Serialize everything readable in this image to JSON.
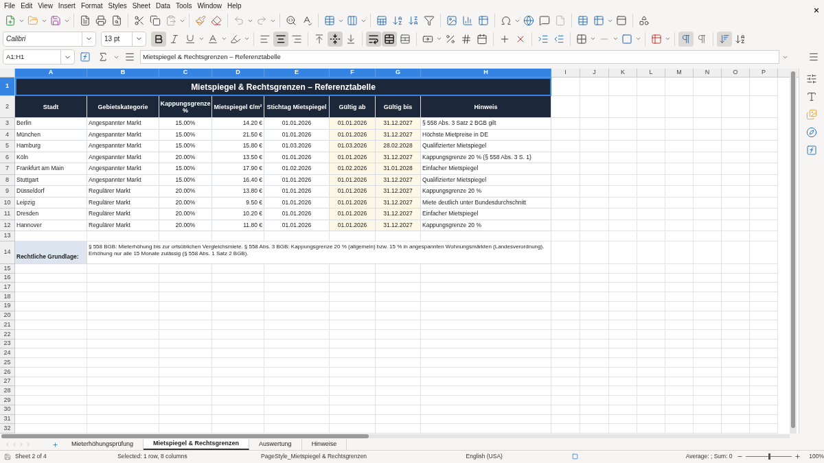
{
  "menu": [
    "File",
    "Edit",
    "View",
    "Insert",
    "Format",
    "Styles",
    "Sheet",
    "Data",
    "Tools",
    "Window",
    "Help"
  ],
  "format_toolbar": {
    "font_name": "Calibri",
    "font_size": "13 pt",
    "buttons": [
      {
        "active": true
      },
      {
        "active": false
      },
      {
        "active": false
      },
      {
        "active": false
      },
      {
        "active": false
      },
      {
        "active": false
      },
      {
        "active": true
      },
      {
        "active": false
      },
      {
        "active": false
      },
      {
        "active": true
      },
      {
        "active": false
      },
      {
        "active": true
      },
      {
        "active": true
      },
      {
        "active": false
      }
    ]
  },
  "formula_bar": {
    "cell_ref": "A1:H1",
    "content": "Mietspiegel & Rechtsgrenzen – Referenztabelle"
  },
  "columns": [
    {
      "label": "A",
      "selected": true
    },
    {
      "label": "B",
      "selected": true
    },
    {
      "label": "C",
      "selected": true
    },
    {
      "label": "D",
      "selected": true
    },
    {
      "label": "E",
      "selected": true
    },
    {
      "label": "F",
      "selected": true
    },
    {
      "label": "G",
      "selected": true
    },
    {
      "label": "H",
      "selected": true
    },
    {
      "label": "I",
      "selected": false
    },
    {
      "label": "J",
      "selected": false
    },
    {
      "label": "K",
      "selected": false
    },
    {
      "label": "L",
      "selected": false
    },
    {
      "label": "M",
      "selected": false
    },
    {
      "label": "N",
      "selected": false
    },
    {
      "label": "O",
      "selected": false
    },
    {
      "label": "P",
      "selected": false
    }
  ],
  "rows": [
    {
      "kind": "title",
      "number": "1",
      "selected": true,
      "text": "Mietspiegel & Rechtsgrenzen – Referenztabelle"
    },
    {
      "kind": "header",
      "number": "2",
      "selected": false,
      "cells": [
        "Stadt",
        "Gebietskategorie",
        "Kappungsgrenze %",
        "Mietspiegel €/m²",
        "Stichtag Mietspiegel",
        "Gültig ab",
        "Gültig bis",
        "Hinweis"
      ]
    },
    {
      "kind": "data",
      "number": "3",
      "selected": false,
      "cells": [
        "Berlin",
        "Angespannter Markt",
        "15.00%",
        "14.20 €",
        "01.01.2026",
        "01.01.2026",
        "31.12.2027",
        "§ 558 Abs. 3 Satz 2 BGB gilt"
      ]
    },
    {
      "kind": "data",
      "number": "4",
      "selected": false,
      "cells": [
        "München",
        "Angespannter Markt",
        "15.00%",
        "21.50 €",
        "01.01.2026",
        "01.01.2026",
        "31.12.2027",
        "Höchste Mietpreise in DE"
      ]
    },
    {
      "kind": "data",
      "number": "5",
      "selected": false,
      "cells": [
        "Hamburg",
        "Angespannter Markt",
        "15.00%",
        "15.80 €",
        "01.03.2026",
        "01.03.2026",
        "28.02.2028",
        "Qualifizierter Mietspiegel"
      ]
    },
    {
      "kind": "data",
      "number": "6",
      "selected": false,
      "cells": [
        "Köln",
        "Angespannter Markt",
        "20.00%",
        "13.50 €",
        "01.01.2026",
        "01.01.2026",
        "31.12.2027",
        "Kappungsgrenze 20 % (§ 558 Abs. 3 S. 1)"
      ]
    },
    {
      "kind": "data",
      "number": "7",
      "selected": false,
      "cells": [
        "Frankfurt am Main",
        "Angespannter Markt",
        "15.00%",
        "17.90 €",
        "01.02.2026",
        "01.02.2026",
        "31.01.2028",
        "Einfacher Mietspiegel"
      ]
    },
    {
      "kind": "data",
      "number": "8",
      "selected": false,
      "cells": [
        "Stuttgart",
        "Angespannter Markt",
        "15.00%",
        "16.40 €",
        "01.01.2026",
        "01.01.2026",
        "31.12.2027",
        "Qualifizierter Mietspiegel"
      ]
    },
    {
      "kind": "data",
      "number": "9",
      "selected": false,
      "cells": [
        "Düsseldorf",
        "Regulärer Markt",
        "20.00%",
        "13.80 €",
        "01.01.2026",
        "01.01.2026",
        "31.12.2027",
        "Kappungsgrenze 20 %"
      ]
    },
    {
      "kind": "data",
      "number": "10",
      "selected": false,
      "cells": [
        "Leipzig",
        "Regulärer Markt",
        "20.00%",
        "9.50 €",
        "01.01.2026",
        "01.01.2026",
        "31.12.2027",
        "Miete deutlich unter Bundesdurchschnitt"
      ]
    },
    {
      "kind": "data",
      "number": "11",
      "selected": false,
      "cells": [
        "Dresden",
        "Regulärer Markt",
        "20.00%",
        "10.20 €",
        "01.01.2026",
        "01.01.2026",
        "31.12.2027",
        "Einfacher Mietspiegel"
      ]
    },
    {
      "kind": "data",
      "number": "12",
      "selected": false,
      "cells": [
        "Hannover",
        "Regulärer Markt",
        "20.00%",
        "11.80 €",
        "01.01.2026",
        "01.01.2026",
        "31.12.2027",
        "Kappungsgrenze 20 %"
      ]
    },
    {
      "kind": "spacer",
      "number": "13",
      "selected": false
    },
    {
      "kind": "note",
      "number": "14",
      "selected": false,
      "label": "Rechtliche Grundlage:",
      "text": "§ 558 BGB: Mieterhöhung bis zur ortsüblichen Vergleichsmiete. § 558 Abs. 3 BGB: Kappungsgrenze 20 % (allgemein) bzw. 15 % in angespannten Wohnungsmärkten (Landesverordnung). Erhöhung nur alle 15 Monate zulässig (§ 558 Abs. 1 Satz 2 BGB)."
    },
    {
      "kind": "empty",
      "number": "15",
      "selected": false
    },
    {
      "kind": "empty",
      "number": "16",
      "selected": false
    },
    {
      "kind": "empty",
      "number": "17",
      "selected": false
    },
    {
      "kind": "empty",
      "number": "18",
      "selected": false
    },
    {
      "kind": "empty",
      "number": "19",
      "selected": false
    },
    {
      "kind": "empty",
      "number": "20",
      "selected": false
    },
    {
      "kind": "empty",
      "number": "21",
      "selected": false
    },
    {
      "kind": "empty",
      "number": "22",
      "selected": false
    },
    {
      "kind": "empty",
      "number": "23",
      "selected": false
    },
    {
      "kind": "empty",
      "number": "24",
      "selected": false
    },
    {
      "kind": "empty",
      "number": "25",
      "selected": false
    },
    {
      "kind": "empty",
      "number": "26",
      "selected": false
    },
    {
      "kind": "empty",
      "number": "27",
      "selected": false
    },
    {
      "kind": "empty",
      "number": "28",
      "selected": false
    },
    {
      "kind": "empty",
      "number": "29",
      "selected": false
    },
    {
      "kind": "empty",
      "number": "30",
      "selected": false
    },
    {
      "kind": "empty",
      "number": "31",
      "selected": false
    },
    {
      "kind": "empty",
      "number": "32",
      "selected": false
    }
  ],
  "sheet_tabs": [
    {
      "label": "Mieterhöhungsprüfung",
      "selected": false
    },
    {
      "label": "Mietspiegel & Rechtsgrenzen",
      "selected": true
    },
    {
      "label": "Auswertung",
      "selected": false
    },
    {
      "label": "Hinweise",
      "selected": false
    }
  ],
  "status_bar": {
    "sheet": "Sheet 2 of 4",
    "selection": "Selected: 1 row, 8 columns",
    "page_style": "PageStyle_Mietspiegel & Rechtsgrenzen",
    "language": "English (USA)",
    "summary": "Average: ; Sum: 0",
    "zoom": {
      "level": 0.5
    },
    "zoom_percent": "100%"
  }
}
